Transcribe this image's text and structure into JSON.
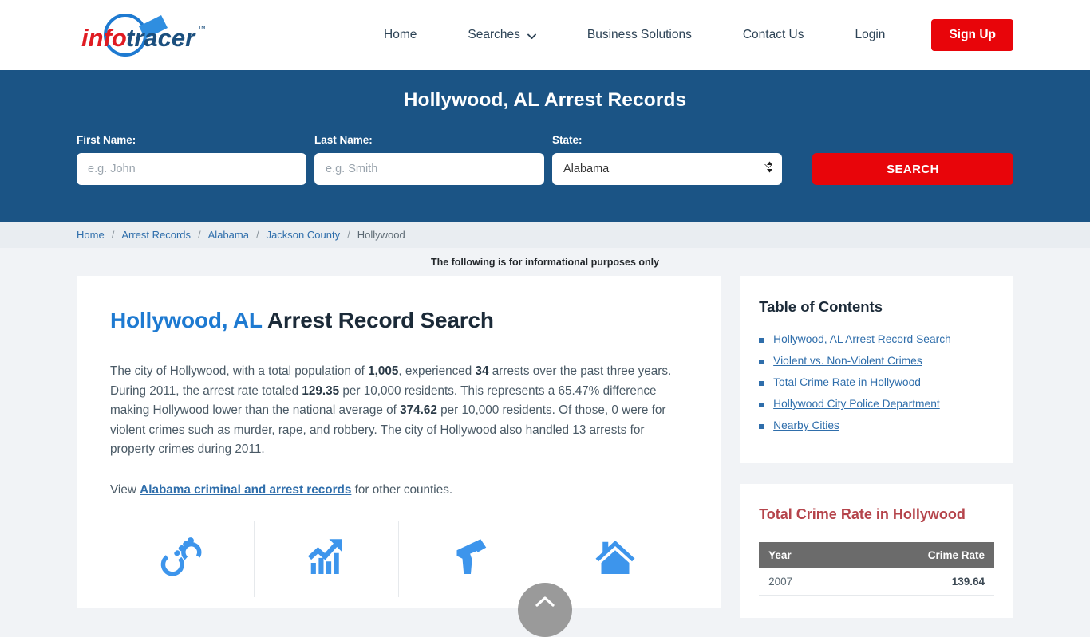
{
  "brand": {
    "logo_text_info": "info",
    "logo_text_tracer": "tracer",
    "logo_tm": "™"
  },
  "nav": {
    "items": [
      {
        "label": "Home",
        "icon": null
      },
      {
        "label": "Searches",
        "icon": "chevron-down-icon"
      },
      {
        "label": "Business Solutions",
        "icon": null
      },
      {
        "label": "Contact Us",
        "icon": null
      },
      {
        "label": "Login",
        "icon": null
      }
    ],
    "signup_label": "Sign Up",
    "signup_color": "#e8050a"
  },
  "hero": {
    "title": "Hollywood, AL Arrest Records",
    "background_color": "#1b5485",
    "first_name_label": "First Name:",
    "first_name_placeholder": "e.g. John",
    "first_name_value": "",
    "last_name_label": "Last Name:",
    "last_name_placeholder": "e.g. Smith",
    "last_name_value": "",
    "state_label": "State:",
    "state_value": "Alabama",
    "state_options": [
      "Alabama"
    ],
    "search_label": "SEARCH"
  },
  "breadcrumb": {
    "items": [
      "Home",
      "Arrest Records",
      "Alabama",
      "Jackson County",
      "Hollywood"
    ],
    "separator": "/"
  },
  "notice": "The following is for informational purposes only",
  "main": {
    "heading": {
      "city": "Hollywood",
      "comma": ", ",
      "state": "AL",
      "rest": " Arrest Record Search"
    },
    "paragraph_parts": [
      {
        "t": "The city of Hollywood, with a total population of ",
        "b": false
      },
      {
        "t": "1,005",
        "b": true
      },
      {
        "t": ", experienced ",
        "b": false
      },
      {
        "t": "34",
        "b": true
      },
      {
        "t": " arrests over the past three years. During 2011, the arrest rate totaled ",
        "b": false
      },
      {
        "t": "129.35",
        "b": true
      },
      {
        "t": " per 10,000 residents. This represents a 65.47% difference making Hollywood lower than the national average of ",
        "b": false
      },
      {
        "t": "374.62",
        "b": true
      },
      {
        "t": " per 10,000 residents. Of those, 0 were for violent crimes such as murder, rape, and robbery. The city of Hollywood also handled 13 arrests for property crimes during 2011.",
        "b": false
      }
    ],
    "view_prefix": "View ",
    "view_link": "Alabama criminal and arrest records",
    "view_suffix": " for other counties.",
    "icons": [
      {
        "name": "handcuffs-icon",
        "color": "#3d95ec"
      },
      {
        "name": "growth-chart-icon",
        "color": "#3d95ec"
      },
      {
        "name": "handgun-icon",
        "color": "#3d95ec"
      },
      {
        "name": "house-icon",
        "color": "#3d95ec"
      }
    ]
  },
  "sidebar": {
    "toc_title": "Table of Contents",
    "toc_items": [
      "Hollywood, AL Arrest Record Search",
      "Violent vs. Non-Violent Crimes",
      "Total Crime Rate in Hollywood",
      "Hollywood City Police Department",
      "Nearby Cities"
    ],
    "crime_title": "Total Crime Rate in Hollywood",
    "crime_table": {
      "columns": [
        "Year",
        "Crime Rate"
      ],
      "rows": [
        {
          "year": "2007",
          "rate": "139.64"
        }
      ]
    }
  },
  "scroll_top": {
    "name": "scroll-to-top-button",
    "icon": "chevron-up-icon"
  }
}
